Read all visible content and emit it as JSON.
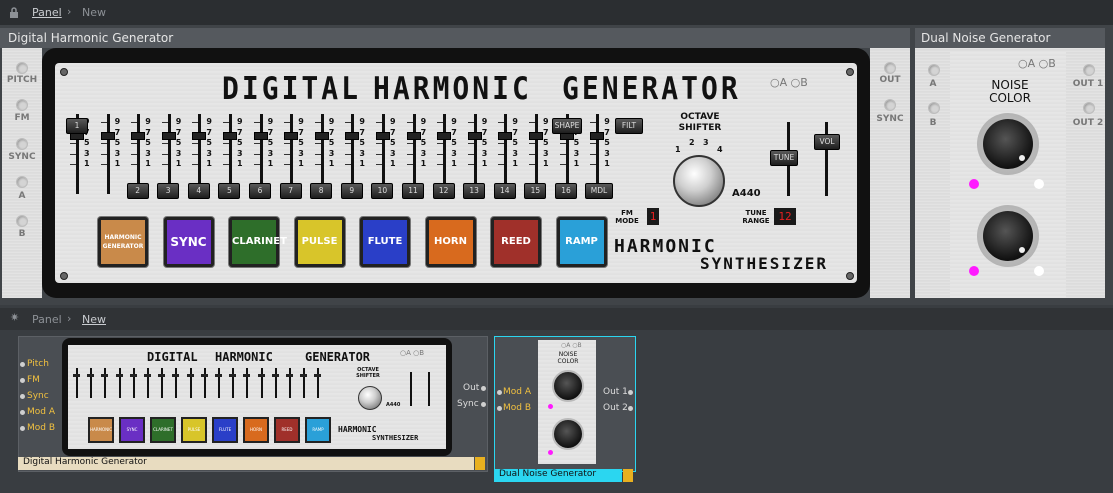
{
  "breadcrumb_top": {
    "panel": "Panel",
    "new": "New"
  },
  "breadcrumb_bottom": {
    "panel": "Panel",
    "new": "New"
  },
  "dhg": {
    "header": "Digital Harmonic Generator",
    "title_words": [
      "DIGITAL",
      "HARMONIC",
      "GENERATOR"
    ],
    "inputs": [
      "PITCH",
      "FM",
      "SYNC",
      "A",
      "B"
    ],
    "outputs": [
      "OUT",
      "SYNC"
    ],
    "ab_indicator": "○A ○B",
    "slider_scale": [
      "9",
      "7",
      "5",
      "3",
      "1"
    ],
    "harmonic_buttons": [
      "1",
      "2",
      "3",
      "4",
      "5",
      "6",
      "7",
      "8",
      "9",
      "10",
      "11",
      "12",
      "13",
      "14",
      "15",
      "16"
    ],
    "shape_label": "SHAPE",
    "filt_label": "FILT",
    "mdl_label": "MDL",
    "octave_label": "OCTAVE SHIFTER",
    "octave_ticks": [
      "1",
      "2",
      "3",
      "4"
    ],
    "tune_label": "TUNE",
    "vol_label": "VOL",
    "a440_label": "A440",
    "fm_mode_label": "FM MODE",
    "fm_mode_value": "1",
    "tune_range_label": "TUNE RANGE",
    "tune_range_value": "12",
    "waves": [
      {
        "label": "HARMONIC GENERATOR",
        "color": "#c98a4a"
      },
      {
        "label": "SYNC",
        "color": "#6a2fc4"
      },
      {
        "label": "CLARINET",
        "color": "#2e6e2a"
      },
      {
        "label": "PULSE",
        "color": "#d8c52a"
      },
      {
        "label": "FLUTE",
        "color": "#2a3fc8"
      },
      {
        "label": "HORN",
        "color": "#d86a1e"
      },
      {
        "label": "REED",
        "color": "#a0302a"
      },
      {
        "label": "RAMP",
        "color": "#2aa0d8"
      }
    ],
    "logo_line1": "HARMONIC",
    "logo_line2": "SYNTHESIZER"
  },
  "dng": {
    "header": "Dual Noise Generator",
    "inputs": [
      "A",
      "B"
    ],
    "outputs": [
      "OUT 1",
      "OUT 2"
    ],
    "ab_indicator": "○A ○B",
    "noise_label": "NOISE COLOR",
    "accent": "#ff1aff"
  },
  "lower": {
    "dhg_ports": [
      "Pitch",
      "FM",
      "Sync",
      "Mod A",
      "Mod B"
    ],
    "dhg_outs": [
      "Out",
      "Sync"
    ],
    "dhg_name": "Digital Harmonic Generator",
    "dng_ins": [
      "Mod A",
      "Mod B"
    ],
    "dng_outs": [
      "Out 1",
      "Out 2"
    ],
    "dng_name": "Dual Noise Generator",
    "mini_title_words": [
      "DIGITAL",
      "HARMONIC",
      "GENERATOR"
    ],
    "mini_ab": "○A ○B",
    "mini_octave": "OCTAVE SHIFTER",
    "mini_a440": "A440",
    "mini_noise": "NOISE COLOR",
    "mini_logo1": "HARMONIC",
    "mini_logo2": "SYNTHESIZER"
  }
}
